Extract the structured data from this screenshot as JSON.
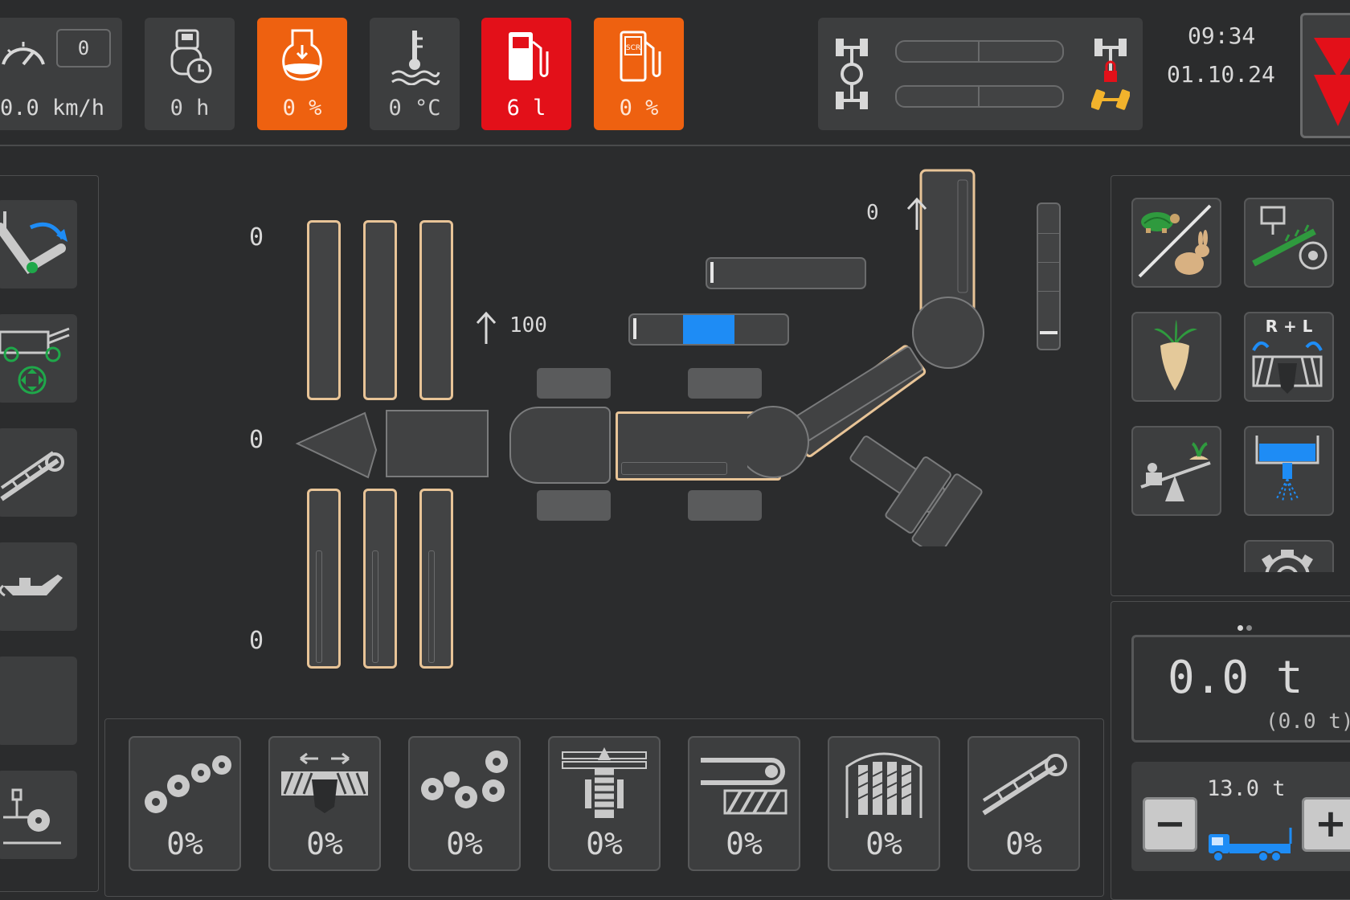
{
  "status_bar": {
    "speed": {
      "gear": "0",
      "value": "0.0 km/h"
    },
    "engine_hours": {
      "value": "0 h"
    },
    "adblue_level": {
      "value": "0 %"
    },
    "coolant_temp": {
      "value": "0 °C"
    },
    "fuel": {
      "value": "6 l"
    },
    "scr_level": {
      "value": "0 %"
    },
    "time": "09:34",
    "date": "01.10.24"
  },
  "colors": {
    "background": "#2b2c2d",
    "tile": "#3d3e3f",
    "warning_orange": "#ee6110",
    "alarm_red": "#e31019",
    "accent_tan": "#e8c497",
    "accent_blue": "#1e8cf5",
    "green": "#1fa84a"
  },
  "machine_view": {
    "left_top_value": "0",
    "left_mid_value": "0",
    "left_bottom_value": "0",
    "center_value": "100",
    "right_top_value": "0",
    "blue_indicator_level": 0.33,
    "right_vertical_level": 0.1
  },
  "left_sidebar": {
    "items": [
      {
        "icon": "crane-arm-swing-icon"
      },
      {
        "icon": "machine-center-icon"
      },
      {
        "icon": "conveyor-icon"
      },
      {
        "icon": "oil-can-icon"
      },
      {
        "icon": ""
      },
      {
        "icon": "cleaning-roller-icon"
      }
    ]
  },
  "right_panel": {
    "buttons": [
      {
        "icon": "turtle-rabbit-speed-icon"
      },
      {
        "icon": "lifter-implement-icon"
      },
      {
        "icon": "sugar-beet-icon"
      },
      {
        "label": "R + L",
        "icon": "rollers-rl-icon"
      },
      {
        "icon": "weighing-scale-icon"
      },
      {
        "icon": "water-spray-icon"
      },
      {
        "icon": "settings-icon"
      }
    ],
    "weight_main": "0.0 t",
    "weight_sub": "(0.0 t)",
    "target_weight": "13.0 t",
    "minus_label": "−",
    "plus_label": "+"
  },
  "bottom_bar": {
    "items": [
      {
        "icon": "cleaning-stars-icon",
        "value": "0%"
      },
      {
        "icon": "spreading-web-icon",
        "value": "0%"
      },
      {
        "icon": "roller-cleaner-icon",
        "value": "0%"
      },
      {
        "icon": "elevator-center-icon",
        "value": "0%"
      },
      {
        "icon": "sieve-belt-icon",
        "value": "0%"
      },
      {
        "icon": "bunker-floor-icon",
        "value": "0%"
      },
      {
        "icon": "unloading-conveyor-icon",
        "value": "0%"
      }
    ]
  }
}
